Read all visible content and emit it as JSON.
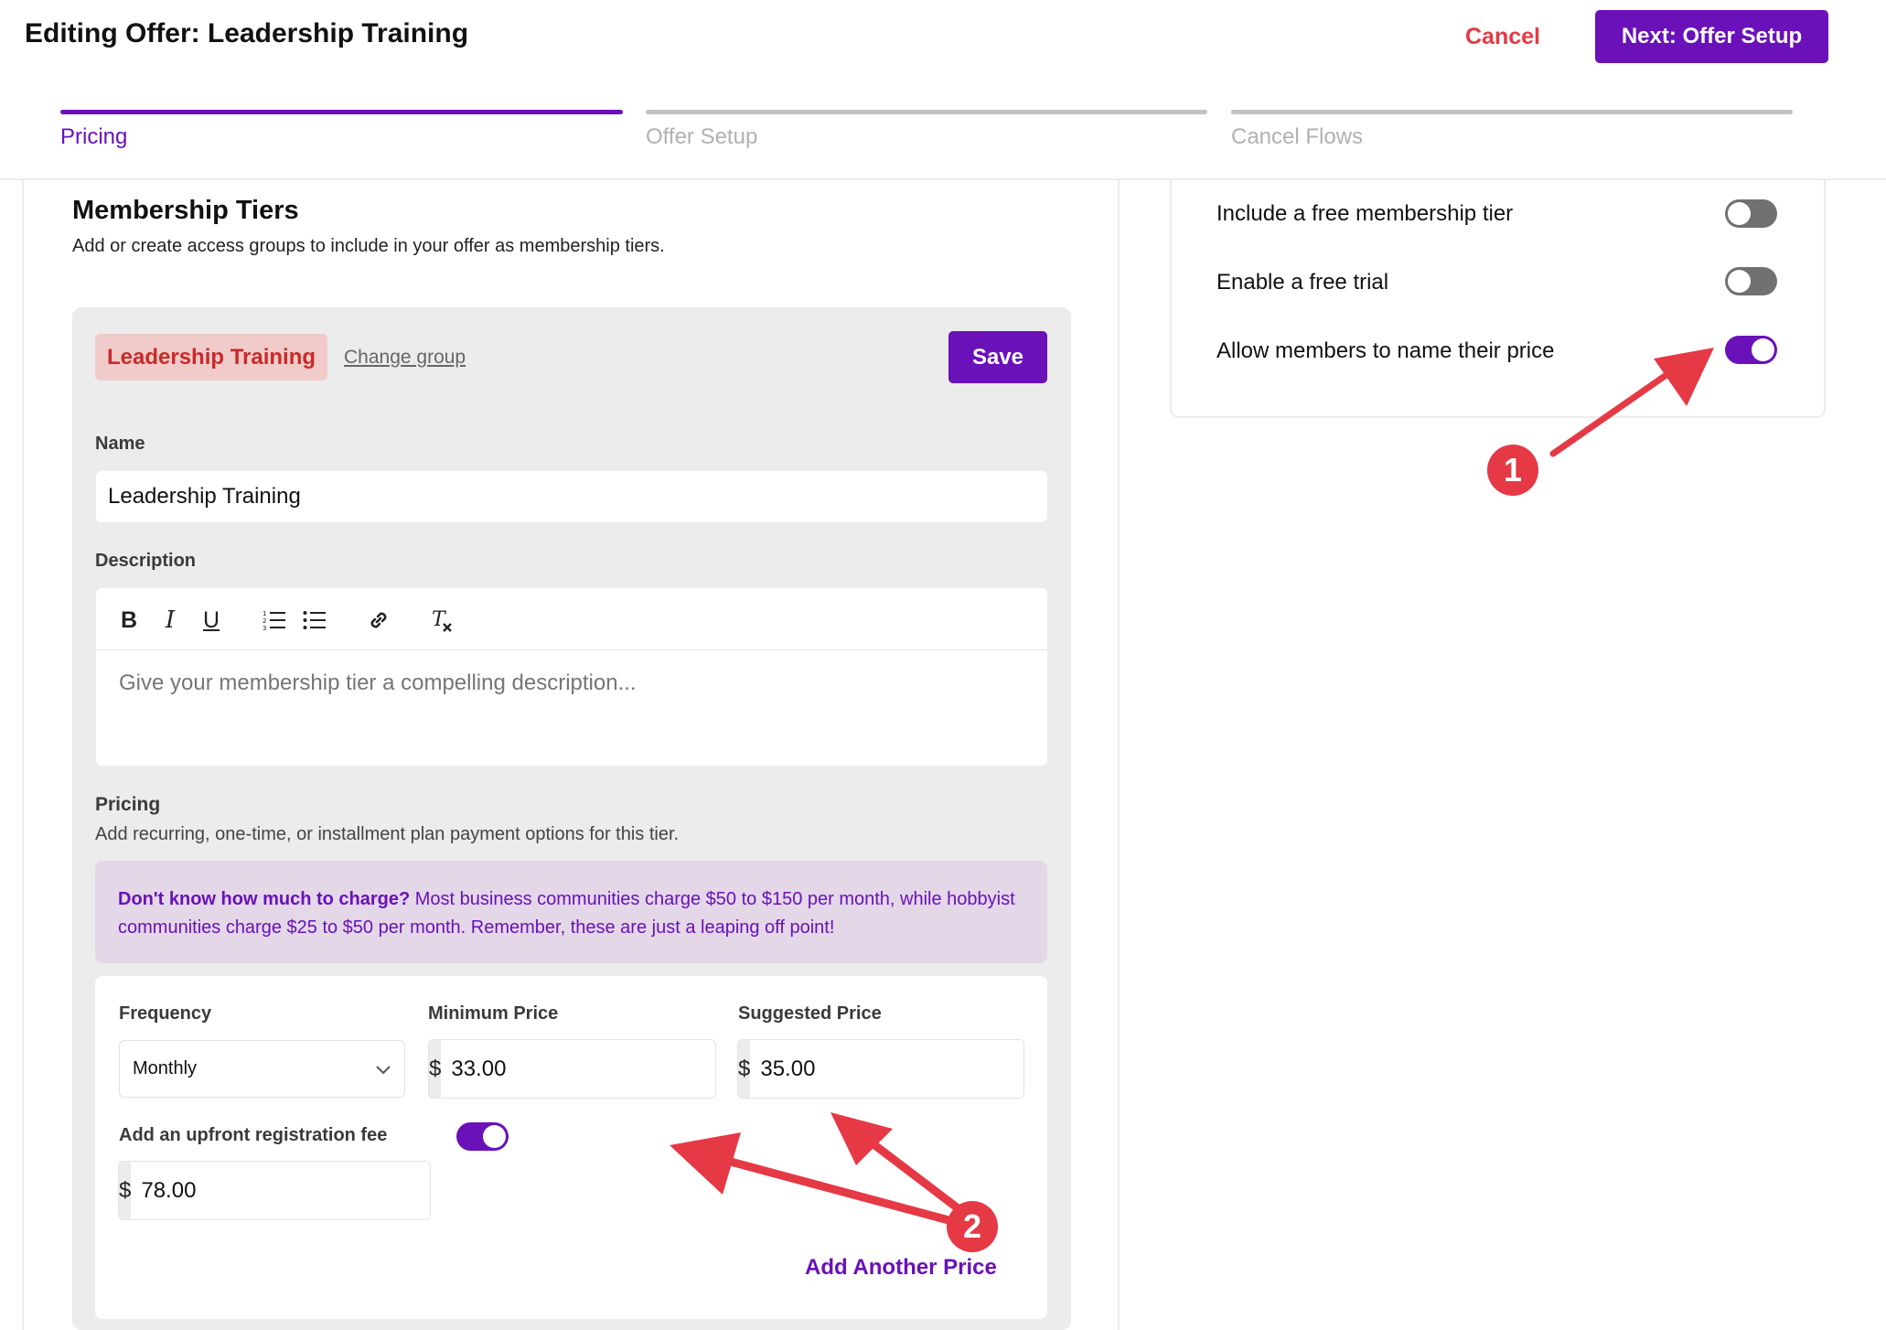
{
  "header": {
    "title": "Editing Offer: Leadership Training",
    "cancel_label": "Cancel",
    "next_label": "Next: Offer Setup"
  },
  "steps": [
    {
      "label": "Pricing",
      "active": true
    },
    {
      "label": "Offer Setup",
      "active": false
    },
    {
      "label": "Cancel Flows",
      "active": false
    }
  ],
  "membership": {
    "title": "Membership Tiers",
    "subtitle": "Add or create access groups to include in your offer as membership tiers.",
    "group_badge": "Leadership Training",
    "change_group": "Change group",
    "save_label": "Save",
    "name_label": "Name",
    "name_value": "Leadership Training",
    "description_label": "Description",
    "description_placeholder": "Give your membership tier a compelling description...",
    "toolbar_icons": [
      "bold-icon",
      "italic-icon",
      "underline-icon",
      "ordered-list-icon",
      "bullet-list-icon",
      "link-icon",
      "clear-format-icon"
    ],
    "pricing_label": "Pricing",
    "pricing_sub": "Add recurring, one-time, or installment plan payment options for this tier.",
    "tip_bold": "Don't know how much to charge?",
    "tip_text": " Most business communities charge $50 to $150 per month, while hobbyist communities charge $25 to $50 per month. Remember, these are just a leaping off point!"
  },
  "price": {
    "frequency_label": "Frequency",
    "frequency_value": "Monthly",
    "min_label": "Minimum Price",
    "min_value": "33.00",
    "suggested_label": "Suggested Price",
    "suggested_value": "35.00",
    "currency": "$",
    "reg_fee_label": "Add an upfront registration fee",
    "reg_fee_on": true,
    "reg_fee_value": "78.00",
    "add_another": "Add Another Price"
  },
  "options": [
    {
      "label": "Include a free membership tier",
      "on": false
    },
    {
      "label": "Enable a free trial",
      "on": false
    },
    {
      "label": "Allow members to name their price",
      "on": true
    }
  ],
  "annotations": {
    "badge1": "1",
    "badge2": "2"
  },
  "colors": {
    "accent": "#6a11b9",
    "danger": "#e53945",
    "annotation": "#e53945"
  }
}
